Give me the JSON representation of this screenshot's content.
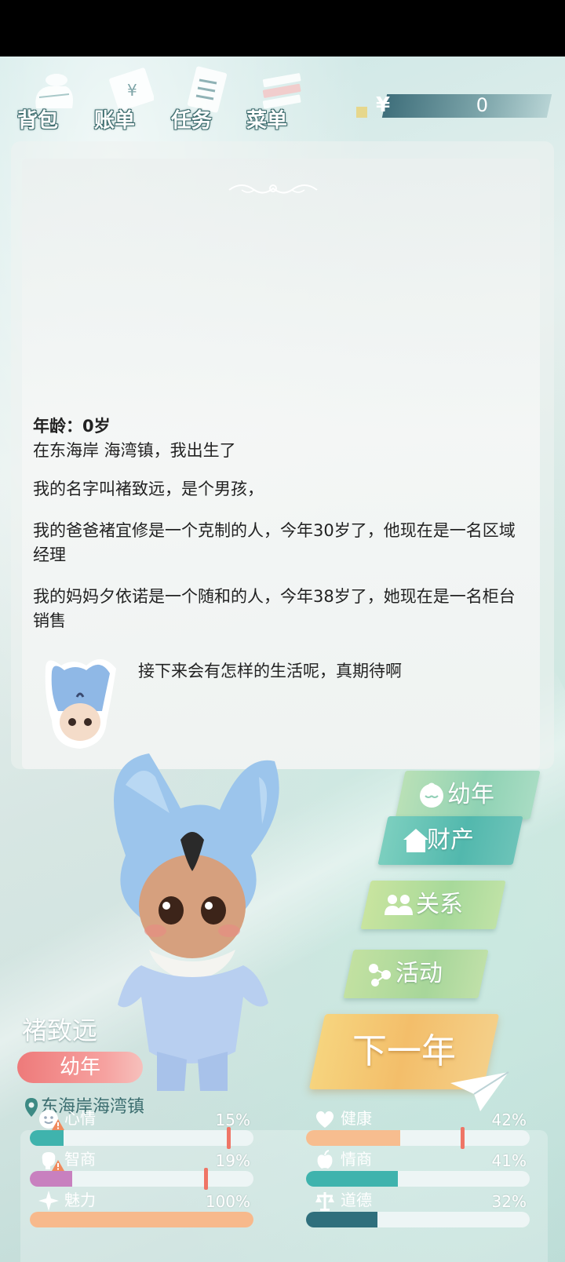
{
  "nav": {
    "bag": "背包",
    "bill": "账单",
    "tasks": "任务",
    "menu": "菜单"
  },
  "money": {
    "symbol": "¥",
    "value": "0"
  },
  "story": {
    "age": "年龄：0岁",
    "line1": "在东海岸 海湾镇，我出生了",
    "line2": "我的名字叫褚致远，是个男孩，",
    "line3": "我的爸爸褚宜修是一个克制的人，今年30岁了，他现在是一名区域经理",
    "line4": "我的妈妈夕依诺是一个随和的人，今年38岁了，她现在是一名柜台销售",
    "thought": "接下来会有怎样的生活呢，真期待啊"
  },
  "actions": {
    "stage": "幼年",
    "property": "财产",
    "relations": "关系",
    "activities": "活动",
    "next_year": "下一年"
  },
  "character": {
    "name": "褚致远",
    "stage": "幼年",
    "location": "东海岸海湾镇"
  },
  "stats": [
    {
      "name": "心情",
      "value": "15%",
      "fraction": 0.15,
      "color": "#3fb3ad",
      "warning": true
    },
    {
      "name": "健康",
      "value": "42%",
      "fraction": 0.42,
      "color": "#f7bd8f",
      "warning": false
    },
    {
      "name": "智商",
      "value": "19%",
      "fraction": 0.19,
      "color": "#c880bf",
      "warning": true
    },
    {
      "name": "情商",
      "value": "41%",
      "fraction": 0.41,
      "color": "#3fb3ad",
      "warning": false
    },
    {
      "name": "魅力",
      "value": "100%",
      "fraction": 1.0,
      "color": "#f7b98c",
      "warning": false
    },
    {
      "name": "道德",
      "value": "32%",
      "fraction": 0.32,
      "color": "#2f6f7c",
      "warning": false
    }
  ]
}
